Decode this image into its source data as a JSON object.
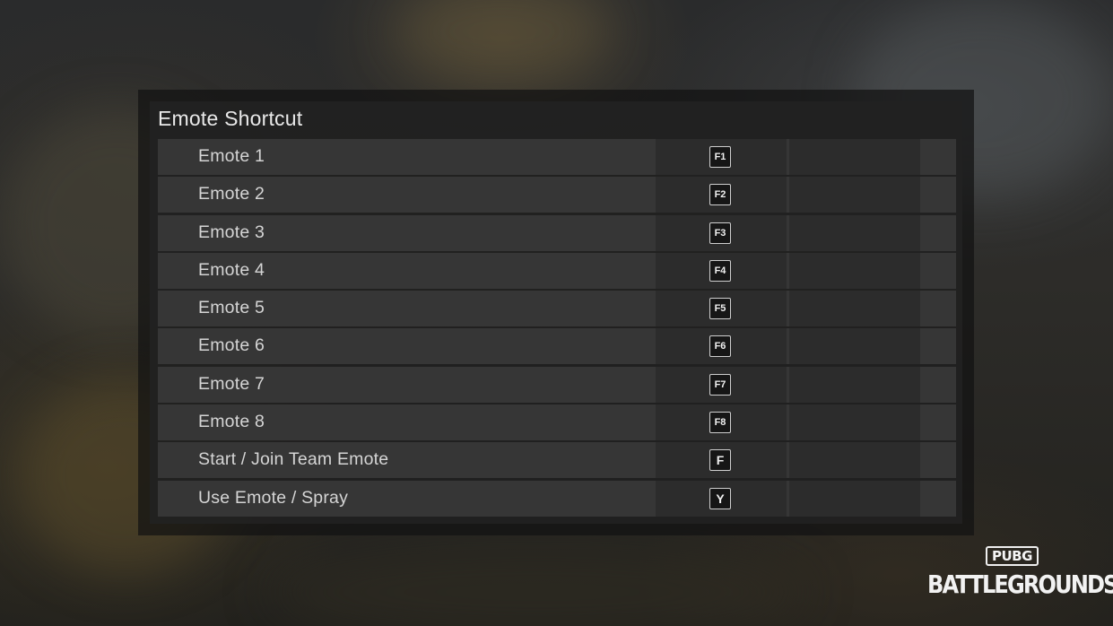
{
  "panel": {
    "title": "Emote Shortcut"
  },
  "rows": [
    {
      "label": "Emote 1",
      "key": "F1"
    },
    {
      "label": "Emote 2",
      "key": "F2"
    },
    {
      "label": "Emote 3",
      "key": "F3"
    },
    {
      "label": "Emote 4",
      "key": "F4"
    },
    {
      "label": "Emote 5",
      "key": "F5"
    },
    {
      "label": "Emote 6",
      "key": "F6"
    },
    {
      "label": "Emote 7",
      "key": "F7"
    },
    {
      "label": "Emote 8",
      "key": "F8"
    },
    {
      "label": "Start / Join Team Emote",
      "key": "F"
    },
    {
      "label": "Use Emote / Spray",
      "key": "Y"
    }
  ],
  "logo": {
    "top": "PUBG",
    "bottom": "BATTLEGROUNDS"
  },
  "colors": {
    "panel": "#222222",
    "row": "#383838",
    "key_slot": "#2c2c2c",
    "text": "#d5d5d5"
  }
}
